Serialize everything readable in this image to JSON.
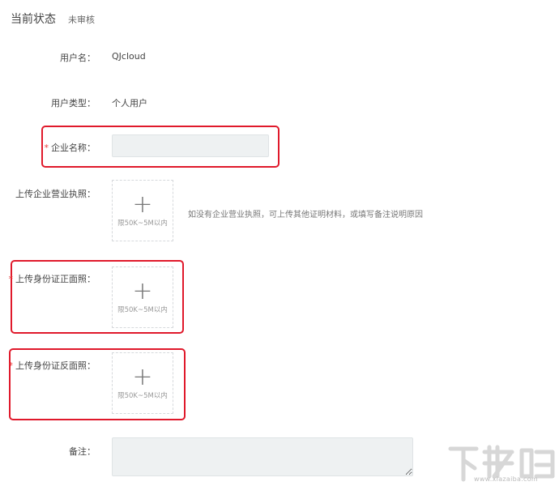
{
  "status": {
    "title": "当前状态",
    "value": "未审核"
  },
  "form": {
    "username": {
      "label": "用户名：",
      "value": "QJcloud"
    },
    "user_type": {
      "label": "用户类型：",
      "value": "个人用户"
    },
    "company_name": {
      "required_mark": "*",
      "label": "企业名称：",
      "value": ""
    },
    "business_license": {
      "label": "上传企业营业执照：",
      "plus": "+",
      "limit": "限50K~5M以内",
      "hint": "如没有企业营业执照，可上传其他证明材料，或填写备注说明原因"
    },
    "id_front": {
      "required_mark": "*",
      "label": "上传身份证正面照：",
      "plus": "+",
      "limit": "限50K~5M以内"
    },
    "id_back": {
      "required_mark": "*",
      "label": "上传身份证反面照：",
      "plus": "+",
      "limit": "限50K~5M以内"
    },
    "remark": {
      "label": "备注：",
      "value": ""
    }
  },
  "watermark": {
    "logo_name": "xiazaiba-logo",
    "url": "www.xiazaiba.com"
  },
  "colors": {
    "highlight": "#e0192b",
    "required": "#e83a3a",
    "input_bg": "#eef1f2"
  }
}
